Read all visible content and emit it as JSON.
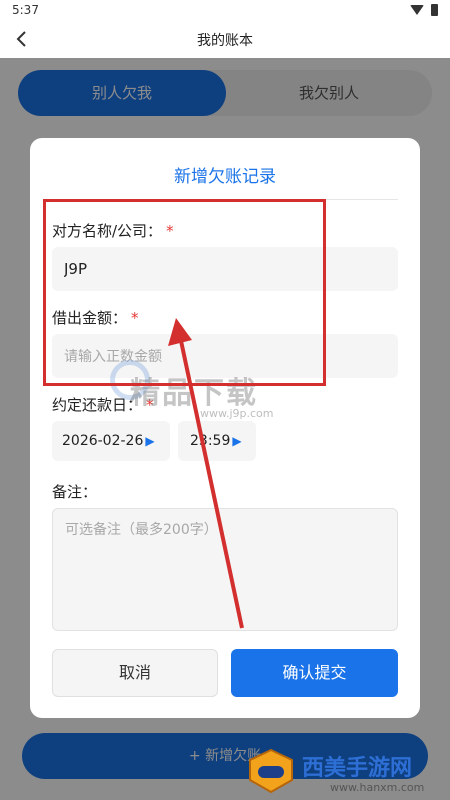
{
  "status_bar": {
    "time": "5:37"
  },
  "nav": {
    "title": "我的账本"
  },
  "background": {
    "tab_active": "别人欠我",
    "tab_inactive": "我欠别人",
    "add_button": "+ 新增欠账"
  },
  "dialog": {
    "title": "新增欠账记录",
    "fields": {
      "counterparty": {
        "label": "对方名称/公司：",
        "required": "*",
        "value": "J9P"
      },
      "amount": {
        "label": "借出金额：",
        "required": "*",
        "placeholder": "请输入正数金额"
      },
      "due_date": {
        "label": "约定还款日：",
        "required": "*",
        "date": "2026-02-26",
        "time": "23:59"
      },
      "note": {
        "label": "备注：",
        "placeholder": "可选备注（最多200字）"
      }
    },
    "cancel": "取消",
    "confirm": "确认提交"
  },
  "watermark": {
    "text": "精品下载",
    "url": "www.j9p.com"
  },
  "corner_brand": {
    "title": "西美手游网",
    "url": "www.hanxm.com"
  },
  "colors": {
    "accent": "#1a73e8",
    "required": "#e53935",
    "annotation": "#d32f2f"
  }
}
